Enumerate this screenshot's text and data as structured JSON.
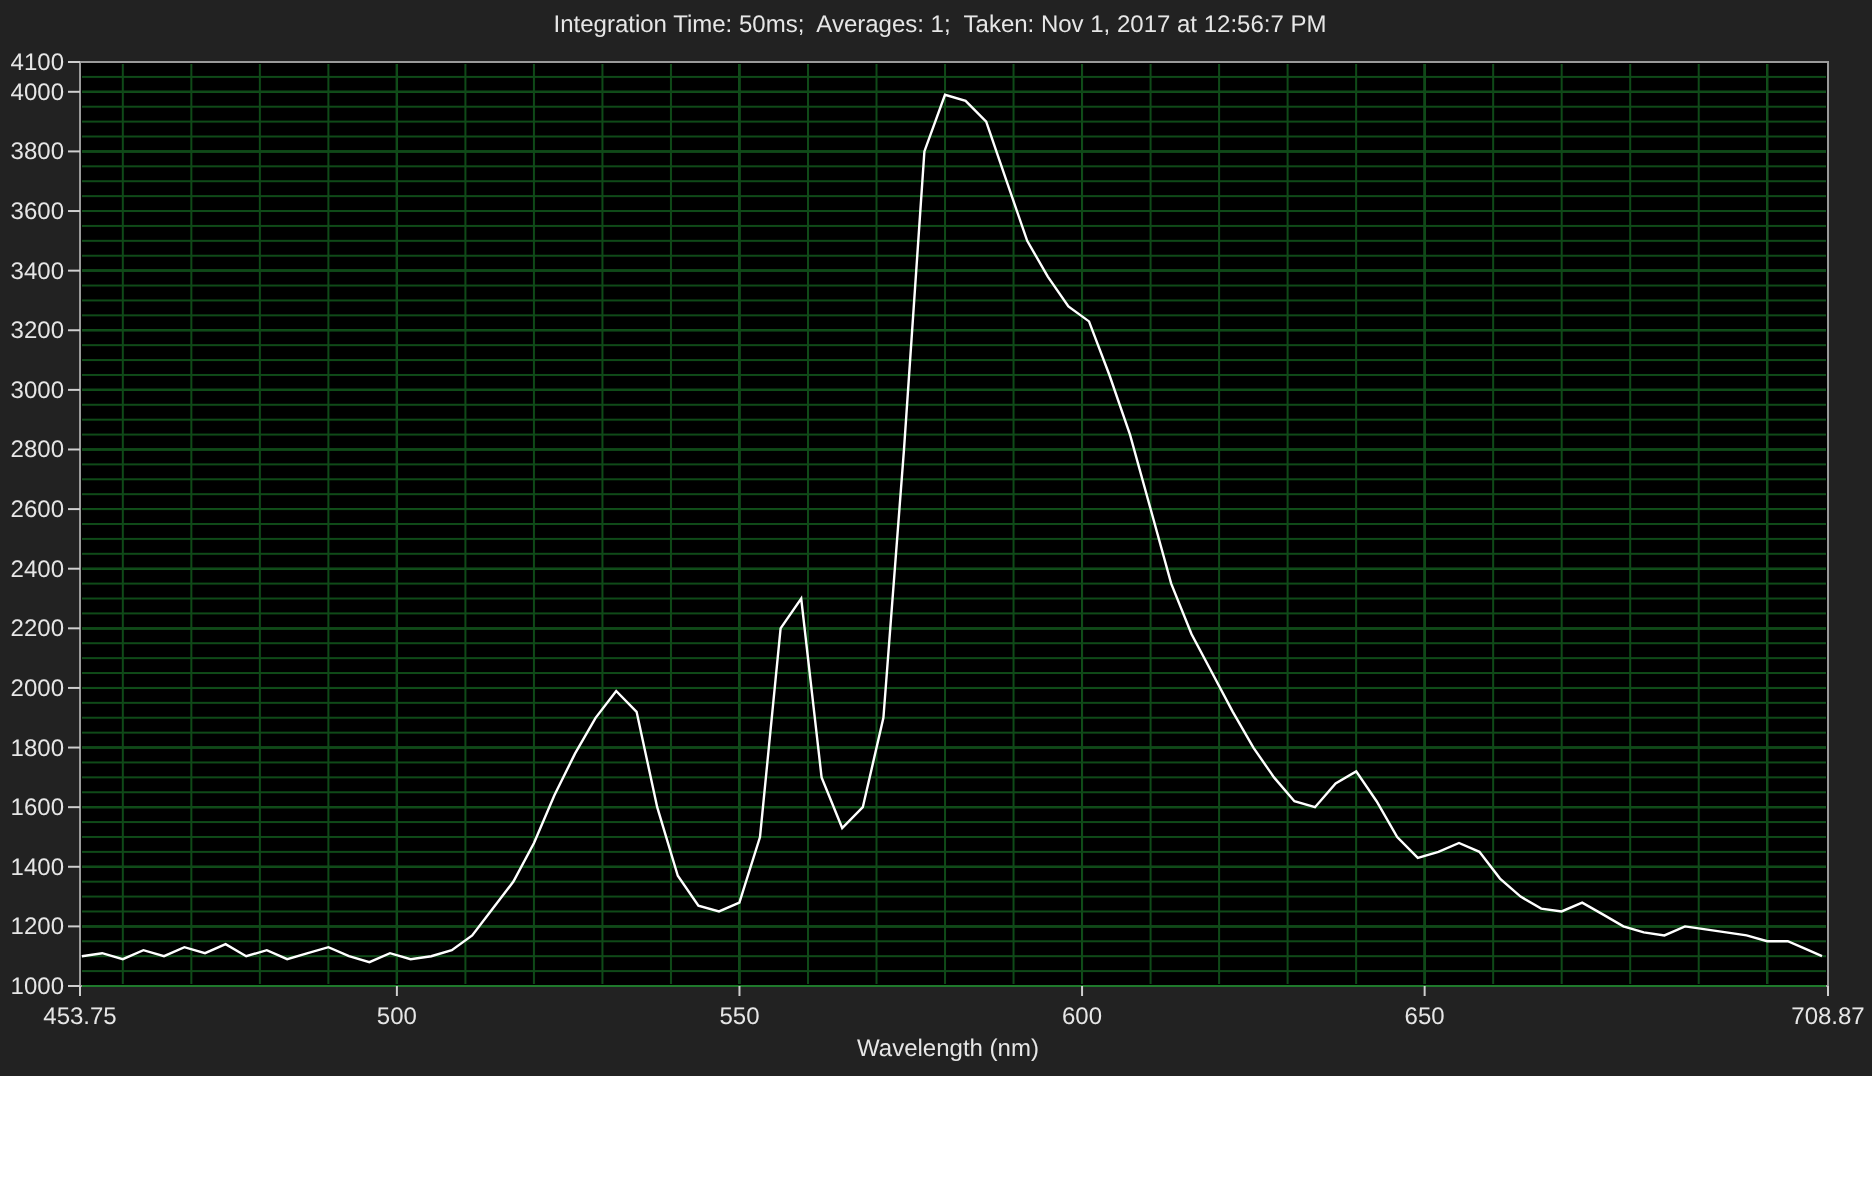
{
  "chart_data": {
    "type": "line",
    "title": "Integration Time: 50ms;  Averages: 1;  Taken: Nov 1, 2017 at 12:56:7 PM",
    "xlabel": "Wavelength (nm)",
    "x": [
      454,
      457,
      460,
      463,
      466,
      469,
      472,
      475,
      478,
      481,
      484,
      487,
      490,
      493,
      496,
      499,
      502,
      505,
      508,
      511,
      514,
      517,
      520,
      523,
      526,
      529,
      532,
      535,
      538,
      541,
      544,
      547,
      550,
      553,
      556,
      559,
      562,
      565,
      568,
      571,
      574,
      577,
      580,
      583,
      586,
      589,
      592,
      595,
      598,
      601,
      604,
      607,
      610,
      613,
      616,
      619,
      622,
      625,
      628,
      631,
      634,
      637,
      640,
      643,
      646,
      649,
      652,
      655,
      658,
      661,
      664,
      667,
      670,
      673,
      676,
      679,
      682,
      685,
      688,
      691,
      694,
      697,
      700,
      703,
      706,
      708
    ],
    "grid": true,
    "series": [
      {
        "color": "#ffffff",
        "values": [
          1100,
          1110,
          1090,
          1120,
          1100,
          1130,
          1110,
          1140,
          1100,
          1120,
          1090,
          1110,
          1130,
          1100,
          1080,
          1110,
          1090,
          1100,
          1120,
          1170,
          1260,
          1350,
          1480,
          1640,
          1780,
          1900,
          1990,
          1920,
          1600,
          1370,
          1270,
          1250,
          1280,
          1500,
          2200,
          2300,
          1700,
          1530,
          1600,
          1900,
          2800,
          3800,
          3990,
          3970,
          3900,
          3700,
          3500,
          3380,
          3280,
          3230,
          3050,
          2850,
          2600,
          2350,
          2180,
          2050,
          1920,
          1800,
          1700,
          1620,
          1600,
          1680,
          1720,
          1620,
          1500,
          1430,
          1450,
          1480,
          1450,
          1360,
          1300,
          1260,
          1250,
          1280,
          1240,
          1200,
          1180,
          1170,
          1200,
          1190,
          1180,
          1170,
          1150,
          1150,
          1120,
          1100
        ]
      }
    ],
    "xlim": [
      453.75,
      708.87
    ],
    "ylim": [
      1000,
      4100
    ],
    "xticks": [
      453.75,
      500,
      550,
      600,
      650,
      708.87
    ],
    "yticks": [
      1000,
      1200,
      1400,
      1600,
      1800,
      2000,
      2200,
      2400,
      2600,
      2800,
      3000,
      3200,
      3400,
      3600,
      3800,
      4000,
      4100
    ]
  }
}
